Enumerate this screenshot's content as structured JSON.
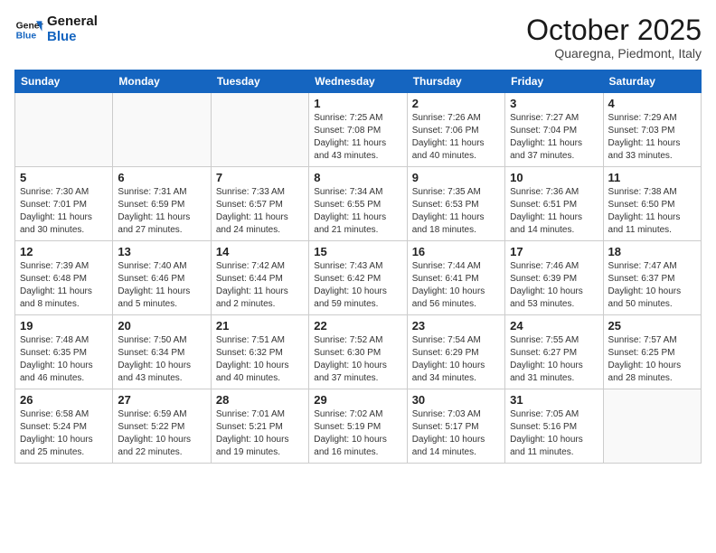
{
  "logo": {
    "general": "General",
    "blue": "Blue"
  },
  "header": {
    "month": "October 2025",
    "location": "Quaregna, Piedmont, Italy"
  },
  "weekdays": [
    "Sunday",
    "Monday",
    "Tuesday",
    "Wednesday",
    "Thursday",
    "Friday",
    "Saturday"
  ],
  "weeks": [
    [
      {
        "day": "",
        "info": ""
      },
      {
        "day": "",
        "info": ""
      },
      {
        "day": "",
        "info": ""
      },
      {
        "day": "1",
        "info": "Sunrise: 7:25 AM\nSunset: 7:08 PM\nDaylight: 11 hours\nand 43 minutes."
      },
      {
        "day": "2",
        "info": "Sunrise: 7:26 AM\nSunset: 7:06 PM\nDaylight: 11 hours\nand 40 minutes."
      },
      {
        "day": "3",
        "info": "Sunrise: 7:27 AM\nSunset: 7:04 PM\nDaylight: 11 hours\nand 37 minutes."
      },
      {
        "day": "4",
        "info": "Sunrise: 7:29 AM\nSunset: 7:03 PM\nDaylight: 11 hours\nand 33 minutes."
      }
    ],
    [
      {
        "day": "5",
        "info": "Sunrise: 7:30 AM\nSunset: 7:01 PM\nDaylight: 11 hours\nand 30 minutes."
      },
      {
        "day": "6",
        "info": "Sunrise: 7:31 AM\nSunset: 6:59 PM\nDaylight: 11 hours\nand 27 minutes."
      },
      {
        "day": "7",
        "info": "Sunrise: 7:33 AM\nSunset: 6:57 PM\nDaylight: 11 hours\nand 24 minutes."
      },
      {
        "day": "8",
        "info": "Sunrise: 7:34 AM\nSunset: 6:55 PM\nDaylight: 11 hours\nand 21 minutes."
      },
      {
        "day": "9",
        "info": "Sunrise: 7:35 AM\nSunset: 6:53 PM\nDaylight: 11 hours\nand 18 minutes."
      },
      {
        "day": "10",
        "info": "Sunrise: 7:36 AM\nSunset: 6:51 PM\nDaylight: 11 hours\nand 14 minutes."
      },
      {
        "day": "11",
        "info": "Sunrise: 7:38 AM\nSunset: 6:50 PM\nDaylight: 11 hours\nand 11 minutes."
      }
    ],
    [
      {
        "day": "12",
        "info": "Sunrise: 7:39 AM\nSunset: 6:48 PM\nDaylight: 11 hours\nand 8 minutes."
      },
      {
        "day": "13",
        "info": "Sunrise: 7:40 AM\nSunset: 6:46 PM\nDaylight: 11 hours\nand 5 minutes."
      },
      {
        "day": "14",
        "info": "Sunrise: 7:42 AM\nSunset: 6:44 PM\nDaylight: 11 hours\nand 2 minutes."
      },
      {
        "day": "15",
        "info": "Sunrise: 7:43 AM\nSunset: 6:42 PM\nDaylight: 10 hours\nand 59 minutes."
      },
      {
        "day": "16",
        "info": "Sunrise: 7:44 AM\nSunset: 6:41 PM\nDaylight: 10 hours\nand 56 minutes."
      },
      {
        "day": "17",
        "info": "Sunrise: 7:46 AM\nSunset: 6:39 PM\nDaylight: 10 hours\nand 53 minutes."
      },
      {
        "day": "18",
        "info": "Sunrise: 7:47 AM\nSunset: 6:37 PM\nDaylight: 10 hours\nand 50 minutes."
      }
    ],
    [
      {
        "day": "19",
        "info": "Sunrise: 7:48 AM\nSunset: 6:35 PM\nDaylight: 10 hours\nand 46 minutes."
      },
      {
        "day": "20",
        "info": "Sunrise: 7:50 AM\nSunset: 6:34 PM\nDaylight: 10 hours\nand 43 minutes."
      },
      {
        "day": "21",
        "info": "Sunrise: 7:51 AM\nSunset: 6:32 PM\nDaylight: 10 hours\nand 40 minutes."
      },
      {
        "day": "22",
        "info": "Sunrise: 7:52 AM\nSunset: 6:30 PM\nDaylight: 10 hours\nand 37 minutes."
      },
      {
        "day": "23",
        "info": "Sunrise: 7:54 AM\nSunset: 6:29 PM\nDaylight: 10 hours\nand 34 minutes."
      },
      {
        "day": "24",
        "info": "Sunrise: 7:55 AM\nSunset: 6:27 PM\nDaylight: 10 hours\nand 31 minutes."
      },
      {
        "day": "25",
        "info": "Sunrise: 7:57 AM\nSunset: 6:25 PM\nDaylight: 10 hours\nand 28 minutes."
      }
    ],
    [
      {
        "day": "26",
        "info": "Sunrise: 6:58 AM\nSunset: 5:24 PM\nDaylight: 10 hours\nand 25 minutes."
      },
      {
        "day": "27",
        "info": "Sunrise: 6:59 AM\nSunset: 5:22 PM\nDaylight: 10 hours\nand 22 minutes."
      },
      {
        "day": "28",
        "info": "Sunrise: 7:01 AM\nSunset: 5:21 PM\nDaylight: 10 hours\nand 19 minutes."
      },
      {
        "day": "29",
        "info": "Sunrise: 7:02 AM\nSunset: 5:19 PM\nDaylight: 10 hours\nand 16 minutes."
      },
      {
        "day": "30",
        "info": "Sunrise: 7:03 AM\nSunset: 5:17 PM\nDaylight: 10 hours\nand 14 minutes."
      },
      {
        "day": "31",
        "info": "Sunrise: 7:05 AM\nSunset: 5:16 PM\nDaylight: 10 hours\nand 11 minutes."
      },
      {
        "day": "",
        "info": ""
      }
    ]
  ]
}
